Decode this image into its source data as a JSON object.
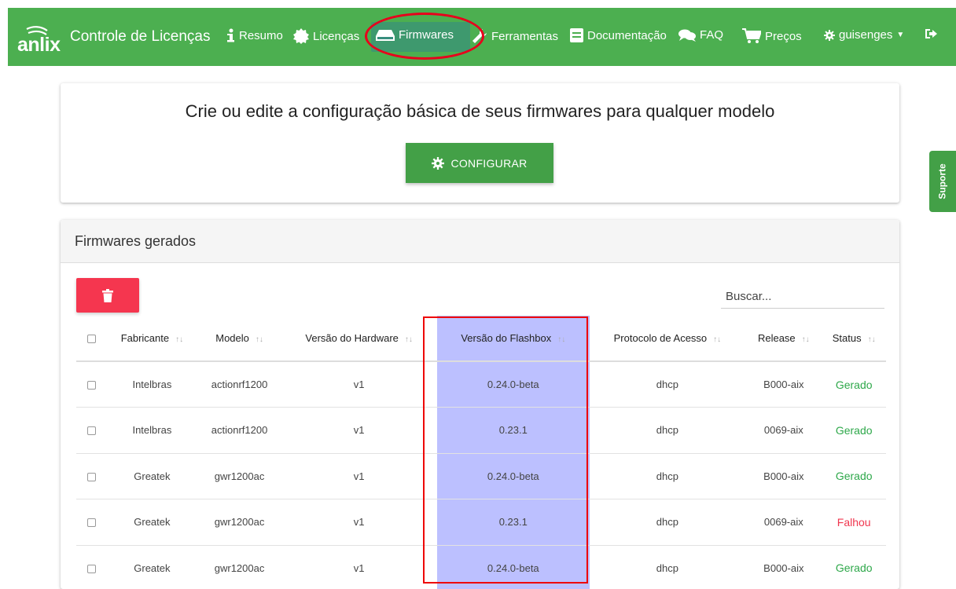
{
  "nav": {
    "brand": "anlix",
    "title": "Controle de Licenças",
    "items": [
      {
        "label": "Resumo",
        "icon": "info-icon"
      },
      {
        "label": "Licenças",
        "icon": "certificate-icon"
      },
      {
        "label": "Firmwares",
        "icon": "hdd-icon",
        "active": true
      },
      {
        "label": "Ferramentas",
        "icon": "wrench-icon"
      },
      {
        "label": "Documentação",
        "icon": "book-icon"
      },
      {
        "label": "FAQ",
        "icon": "comments-icon"
      },
      {
        "label": "Preços",
        "icon": "cart-icon"
      }
    ],
    "user": "guisenges",
    "logout_icon": "sign-out-icon"
  },
  "support": {
    "label": "Suporte"
  },
  "config_card": {
    "heading": "Crie ou edite a configuração básica de seus firmwares para qualquer modelo",
    "button": "CONFIGURAR"
  },
  "table_card": {
    "title": "Firmwares gerados",
    "search_placeholder": "Buscar...",
    "columns": [
      "Fabricante",
      "Modelo",
      "Versão do Hardware",
      "Versão do Flashbox",
      "Protocolo de Acesso",
      "Release",
      "Status"
    ],
    "sort_glyph": "↑↓",
    "rows": [
      {
        "fabricante": "Intelbras",
        "modelo": "actionrf1200",
        "hw": "v1",
        "flashbox": "0.24.0-beta",
        "protocolo": "dhcp",
        "release": "B000-aix",
        "status": "Gerado",
        "ok": true
      },
      {
        "fabricante": "Intelbras",
        "modelo": "actionrf1200",
        "hw": "v1",
        "flashbox": "0.23.1",
        "protocolo": "dhcp",
        "release": "0069-aix",
        "status": "Gerado",
        "ok": true
      },
      {
        "fabricante": "Greatek",
        "modelo": "gwr1200ac",
        "hw": "v1",
        "flashbox": "0.24.0-beta",
        "protocolo": "dhcp",
        "release": "B000-aix",
        "status": "Gerado",
        "ok": true
      },
      {
        "fabricante": "Greatek",
        "modelo": "gwr1200ac",
        "hw": "v1",
        "flashbox": "0.23.1",
        "protocolo": "dhcp",
        "release": "0069-aix",
        "status": "Falhou",
        "ok": false
      },
      {
        "fabricante": "Greatek",
        "modelo": "gwr1200ac",
        "hw": "v1",
        "flashbox": "0.24.0-beta",
        "protocolo": "dhcp",
        "release": "B000-aix",
        "status": "Gerado",
        "ok": true
      }
    ]
  },
  "colors": {
    "navbar": "#4caf50",
    "ok": "#2ea84a",
    "fail": "#f0374f",
    "delete": "#f5364f",
    "highlight": "#bcc0ff"
  }
}
